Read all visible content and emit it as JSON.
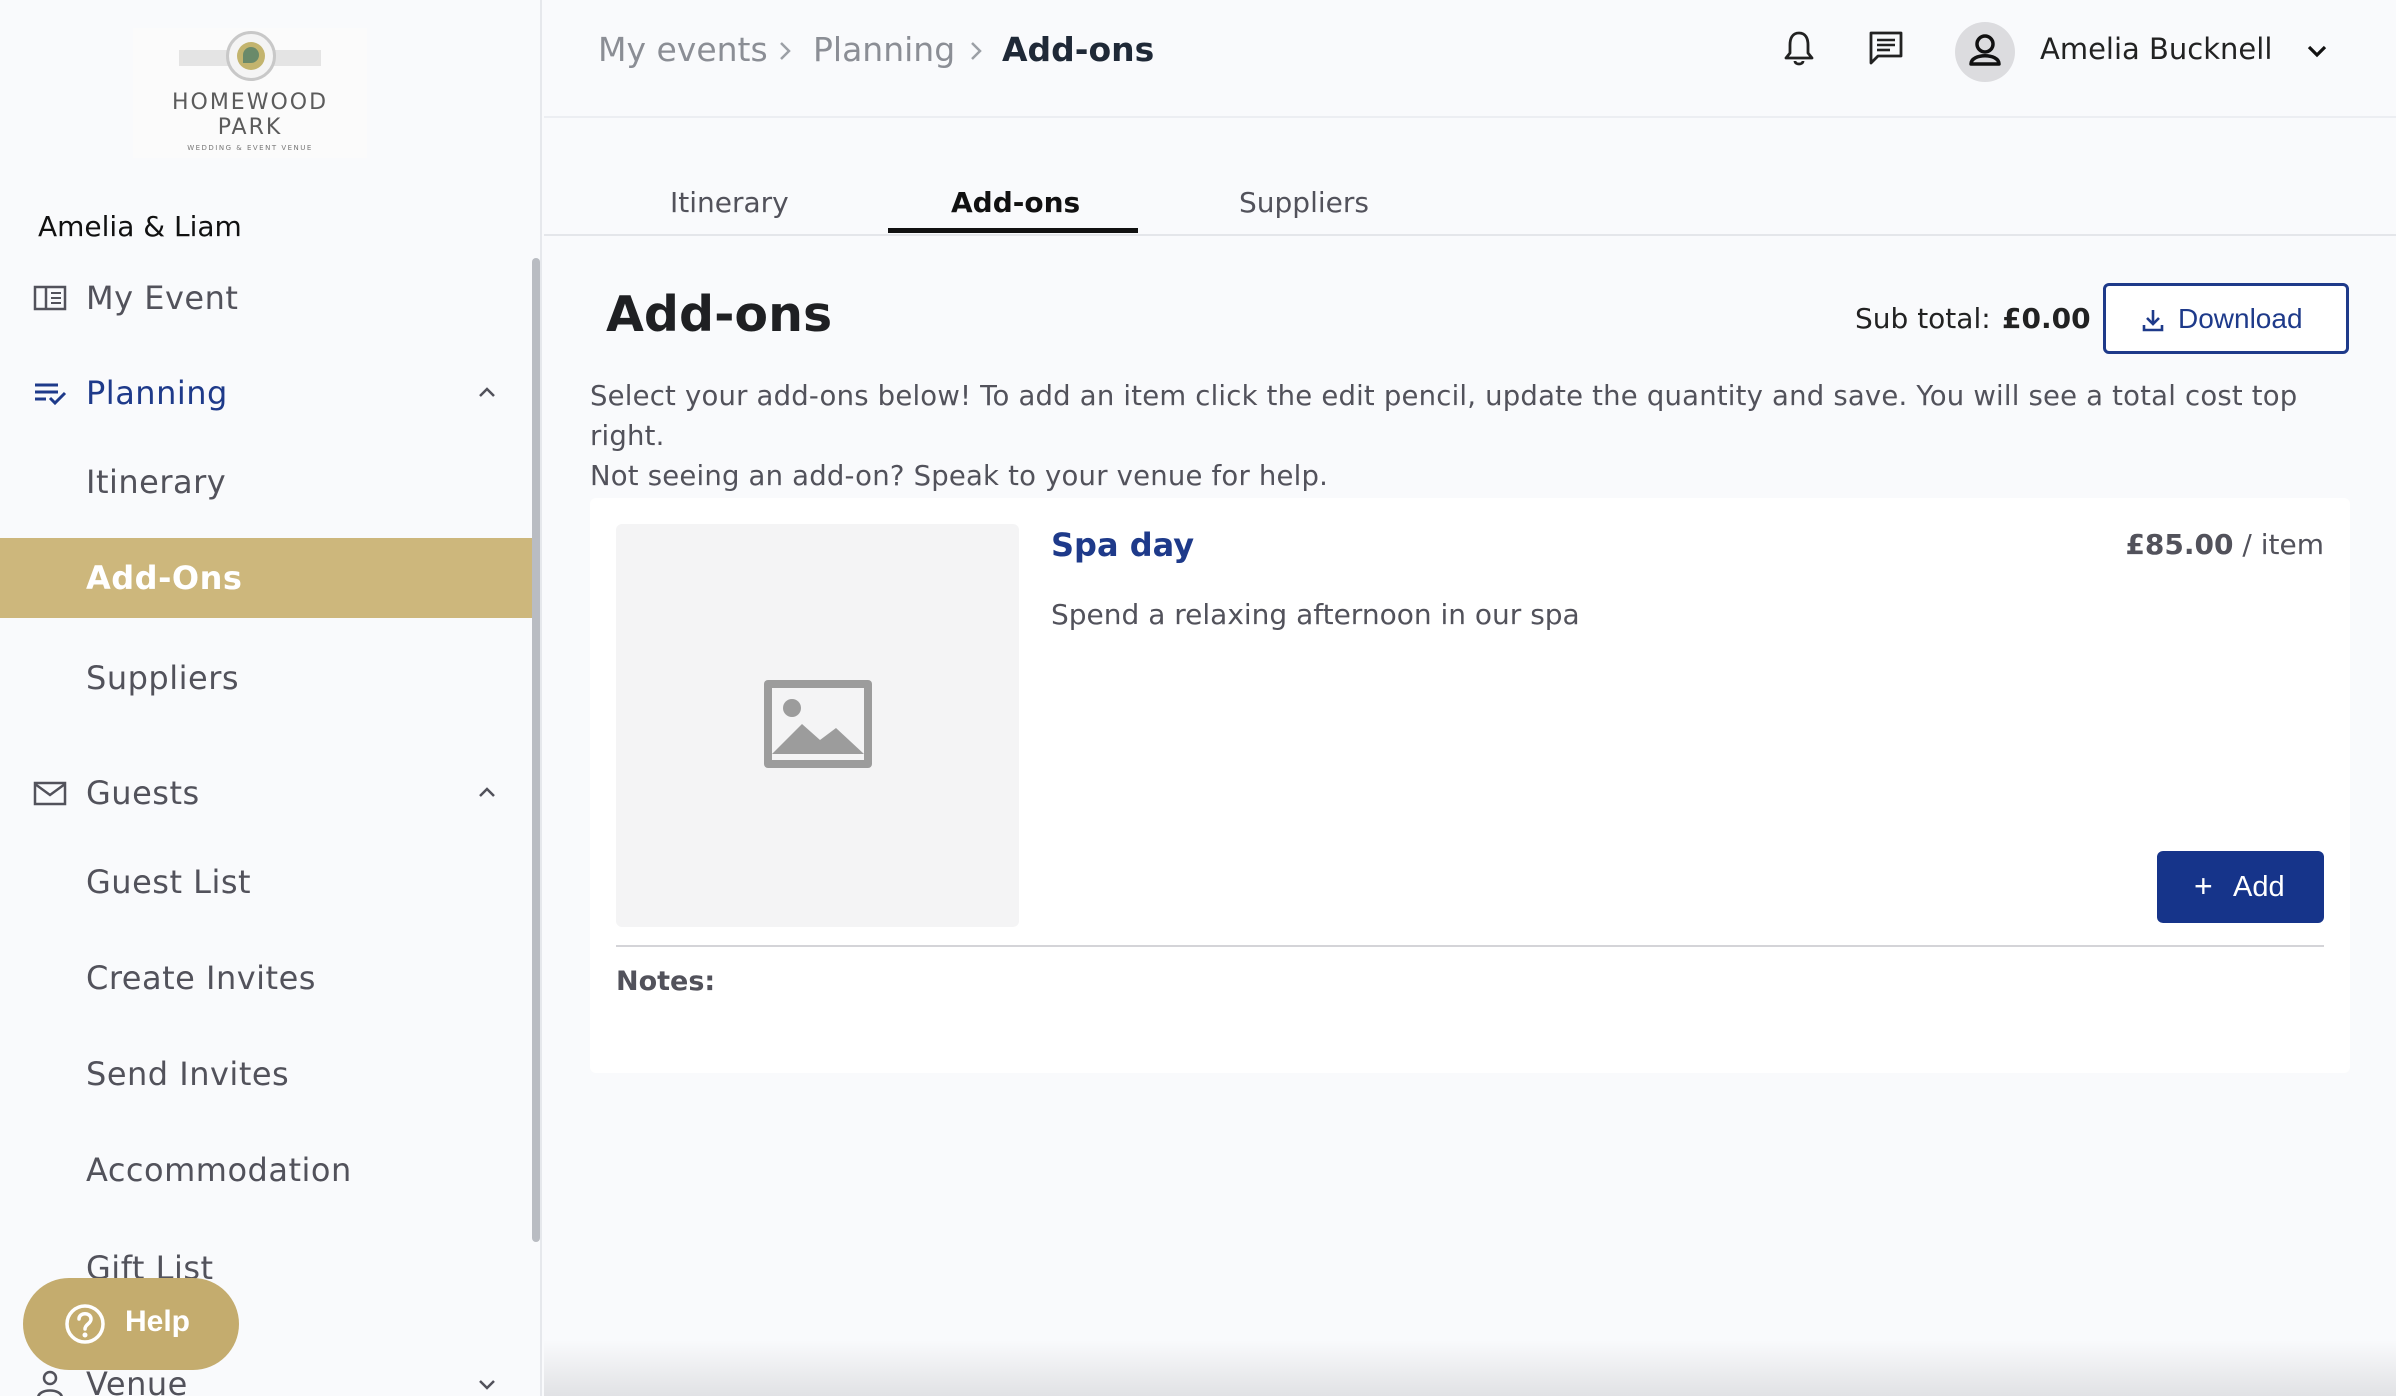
{
  "sidebar": {
    "logo": {
      "brand_line1": "HOMEWOOD",
      "brand_line2": "PARK",
      "tagline": "WEDDING & EVENT VENUE"
    },
    "couple": "Amelia & Liam",
    "items": [
      {
        "label": "My Event",
        "icon": "book-open-icon"
      },
      {
        "label": "Planning",
        "icon": "checklist-icon",
        "expanded": true
      },
      {
        "label": "Itinerary"
      },
      {
        "label": "Add-Ons",
        "active": true
      },
      {
        "label": "Suppliers"
      },
      {
        "label": "Guests",
        "icon": "envelope-icon",
        "expanded": true
      },
      {
        "label": "Guest List"
      },
      {
        "label": "Create Invites"
      },
      {
        "label": "Send Invites"
      },
      {
        "label": "Accommodation"
      },
      {
        "label": "Gift List"
      },
      {
        "label": "Venue",
        "icon": "person-icon",
        "expanded": false
      }
    ],
    "help_label": "Help"
  },
  "header": {
    "breadcrumb": [
      "My events",
      "Planning",
      "Add-ons"
    ],
    "user_name": "Amelia Bucknell"
  },
  "tabs": [
    {
      "label": "Itinerary"
    },
    {
      "label": "Add-ons",
      "active": true
    },
    {
      "label": "Suppliers"
    }
  ],
  "main": {
    "title": "Add-ons",
    "subtotal_label": "Sub total:",
    "subtotal_value": "£0.00",
    "download_label": "Download",
    "intro_line1": "Select your add-ons below! To add an item click the edit pencil, update the quantity and save. You will see a total cost top right.",
    "intro_line2": "Not seeing an add-on? Speak to your venue for help."
  },
  "addon": {
    "title": "Spa day",
    "price": "£85.00",
    "unit": " / item",
    "description": "Spend a relaxing afternoon in our spa",
    "add_label": "Add",
    "notes_label": "Notes:"
  },
  "colors": {
    "accent_navy": "#1e3a8a",
    "active_gold": "#cdb77c",
    "help_gold": "#c4ac6e"
  }
}
